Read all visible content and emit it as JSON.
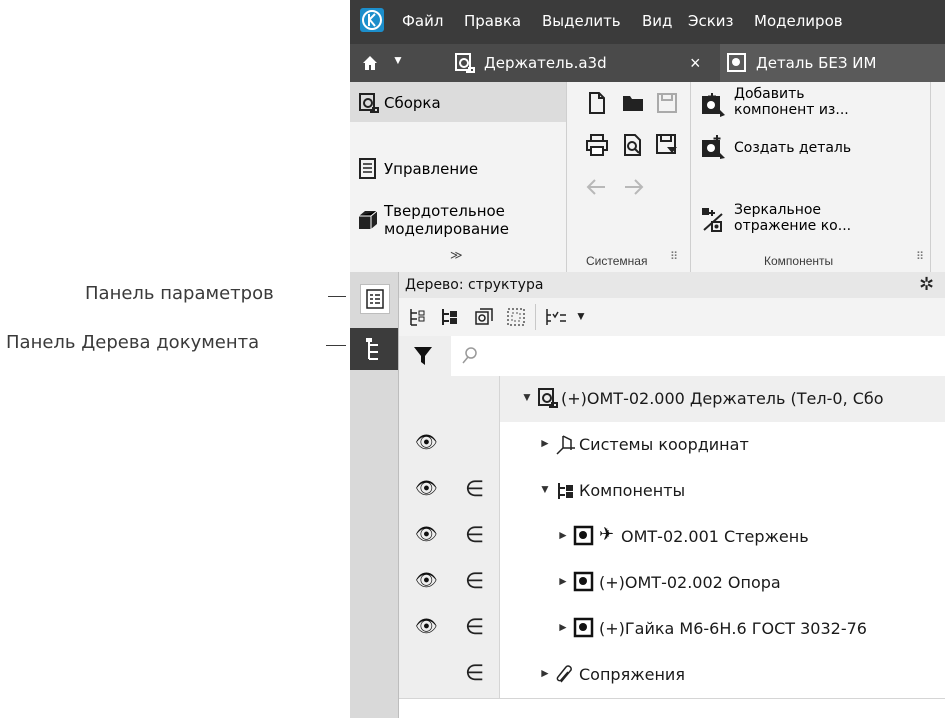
{
  "callouts": {
    "params_panel": "Панель параметров",
    "tree_panel": "Панель Дерева документа"
  },
  "menu": {
    "items": [
      "Файл",
      "Правка",
      "Выделить",
      "Вид",
      "Эскиз",
      "Моделиров"
    ]
  },
  "tabs": {
    "active_label": "Держатель.a3d",
    "close_glyph": "×",
    "second_label": "Деталь БЕЗ ИМ"
  },
  "ribbon": {
    "left": [
      "Сборка",
      "Управление",
      "Твердотельное",
      "моделирование"
    ],
    "expand_glyph": "≫",
    "group_system": "Системная",
    "group_components": "Компоненты",
    "add_component": [
      "Добавить",
      "компонент из..."
    ],
    "create_part": "Создать деталь",
    "mirror": [
      "Зеркальное",
      "отражение ко..."
    ]
  },
  "tree": {
    "header": "Дерево: структура",
    "search_placeholder": "",
    "rows": [
      {
        "text": "(+)ОМТ-02.000 Держатель (Тел-0, Сбо"
      },
      {
        "text": "Системы координат"
      },
      {
        "text": "Компоненты"
      },
      {
        "text": "ОМТ-02.001 Стержень"
      },
      {
        "text": "(+)ОМТ-02.002 Опора"
      },
      {
        "text": "(+)Гайка М6-6Н.6 ГОСТ 3032-76"
      },
      {
        "text": "Сопряжения"
      }
    ],
    "belongs_glyph": "∈"
  },
  "colors": {
    "menubar": "#3b3b3b",
    "tabbar": "#4a4a4a",
    "logo": "#1c8ecb"
  }
}
